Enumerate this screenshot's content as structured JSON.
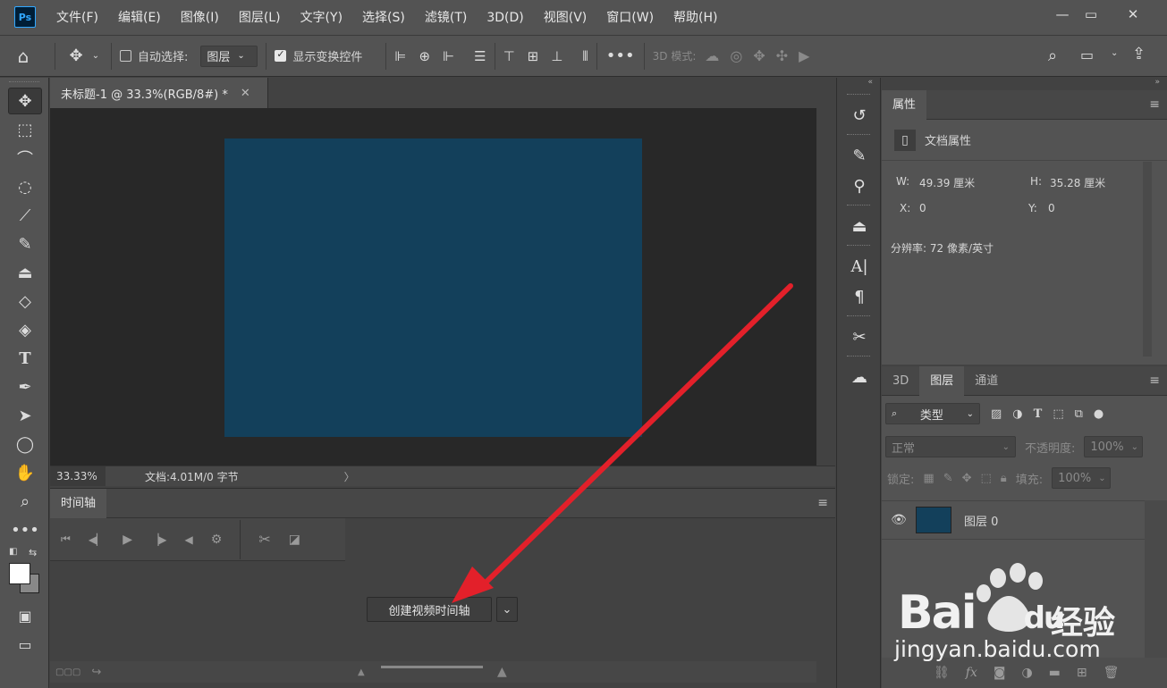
{
  "app": {
    "logo": "Ps"
  },
  "menu": [
    "文件(F)",
    "编辑(E)",
    "图像(I)",
    "图层(L)",
    "文字(Y)",
    "选择(S)",
    "滤镜(T)",
    "3D(D)",
    "视图(V)",
    "窗口(W)",
    "帮助(H)"
  ],
  "options": {
    "auto_select_label": "自动选择:",
    "auto_select_value": "图层",
    "show_transform_label": "显示变换控件",
    "mode_3d_label": "3D 模式:"
  },
  "document": {
    "tab_title": "未标题-1 @ 33.3%(RGB/8#) *",
    "zoom": "33.33%",
    "doc_info": "文档:4.01M/0 字节",
    "canvas_color": "#13405b"
  },
  "timeline": {
    "tab": "时间轴",
    "create_button": "创建视频时间轴"
  },
  "properties": {
    "tab": "属性",
    "doc_props": "文档属性",
    "w_label": "W:",
    "w_value": "49.39 厘米",
    "h_label": "H:",
    "h_value": "35.28 厘米",
    "x_label": "X:",
    "x_value": "0",
    "y_label": "Y:",
    "y_value": "0",
    "resolution": "分辨率: 72 像素/英寸"
  },
  "layers": {
    "tabs": [
      "3D",
      "图层",
      "通道"
    ],
    "filter_kind": "类型",
    "blend_mode": "正常",
    "opacity_label": "不透明度:",
    "opacity_value": "100%",
    "lock_label": "锁定:",
    "fill_label": "填充:",
    "fill_value": "100%",
    "layer_name": "图层 0",
    "fx_label": "fx"
  },
  "watermark": {
    "brand": "Bai",
    "brand2": "du",
    "suffix": "经验",
    "url": "jingyan.baidu.com"
  },
  "colors": {
    "accent": "#31a8ff",
    "arrow": "#e3202a"
  }
}
